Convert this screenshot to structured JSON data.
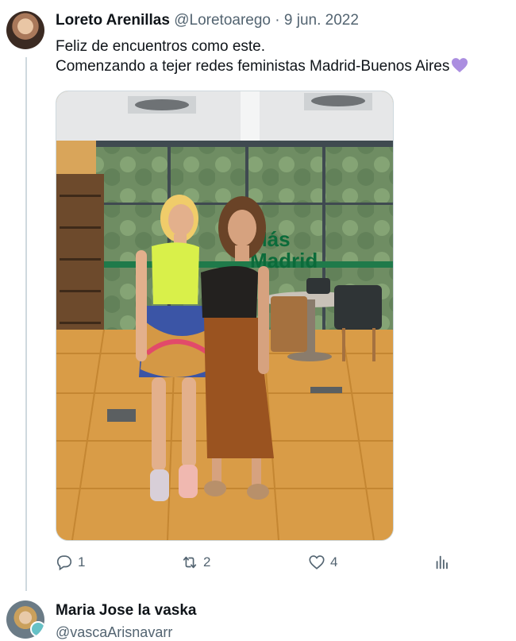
{
  "tweet": {
    "author_name": "Loreto Arenillas",
    "author_handle": "@Loretoarego",
    "separator": "·",
    "date": "9 jun. 2022",
    "text_line1": "Feliz de encuentros como este.",
    "text_line2": "Comenzando a tejer redes feministas Madrid-Buenos Aires",
    "emoji": "purple-heart-icon",
    "photo": {
      "wall_text_line1": "Más",
      "wall_text_line2": "Madrid",
      "brand_color": "#0b6b3a"
    },
    "actions": {
      "reply_count": "1",
      "retweet_count": "2",
      "like_count": "4"
    }
  },
  "reply": {
    "author_name": "Maria Jose la vaska",
    "author_handle": "@vascaArisnavarr"
  },
  "colors": {
    "text": "#0f1419",
    "muted": "#536471",
    "thread_line": "#cfd9de",
    "heart": "#ab8ee0"
  }
}
